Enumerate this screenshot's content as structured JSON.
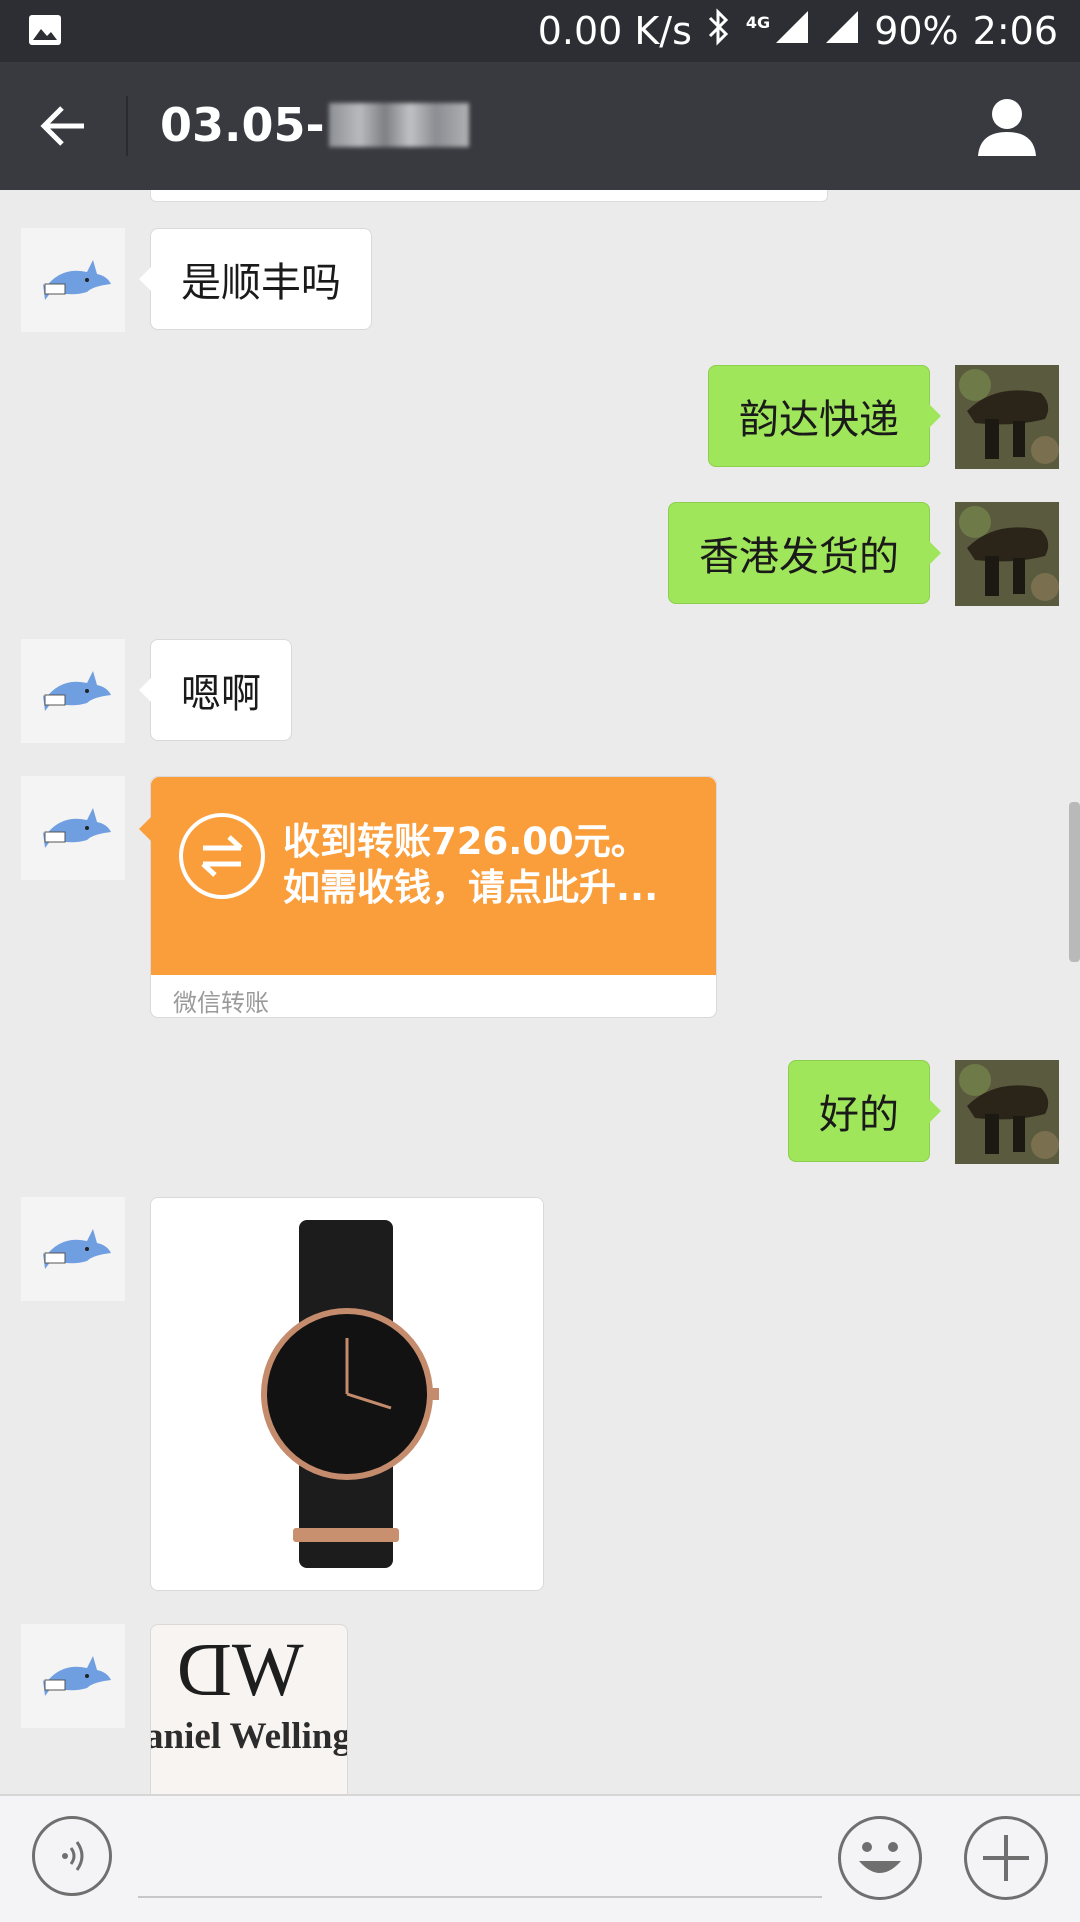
{
  "status_bar": {
    "network_speed": "0.00 K/s",
    "network_type": "4G",
    "battery": "90%",
    "time": "2:06"
  },
  "header": {
    "title_prefix": "03.05-",
    "title_masked_char": "张"
  },
  "messages": [
    {
      "side": "left",
      "type": "text",
      "text": "是顺丰吗"
    },
    {
      "side": "right",
      "type": "text",
      "text": "韵达快递"
    },
    {
      "side": "right",
      "type": "text",
      "text": "香港发货的"
    },
    {
      "side": "left",
      "type": "text",
      "text": "嗯啊"
    },
    {
      "side": "left",
      "type": "transfer",
      "line1": "收到转账726.00元。",
      "line2": "如需收钱，请点此升...",
      "footer": "微信转账"
    },
    {
      "side": "right",
      "type": "text",
      "text": "好的"
    },
    {
      "side": "left",
      "type": "image",
      "subject": "watch-image"
    },
    {
      "side": "left",
      "type": "image",
      "subject": "brand-logo-image",
      "logo_text": "DW",
      "brand_text": "aniel Wellingt"
    }
  ],
  "colors": {
    "header_bg": "#393a3f",
    "status_bg": "#2d2e33",
    "chat_bg": "#ebebeb",
    "sent_bubble": "#9fe65a",
    "transfer_orange": "#fa9d3b"
  }
}
